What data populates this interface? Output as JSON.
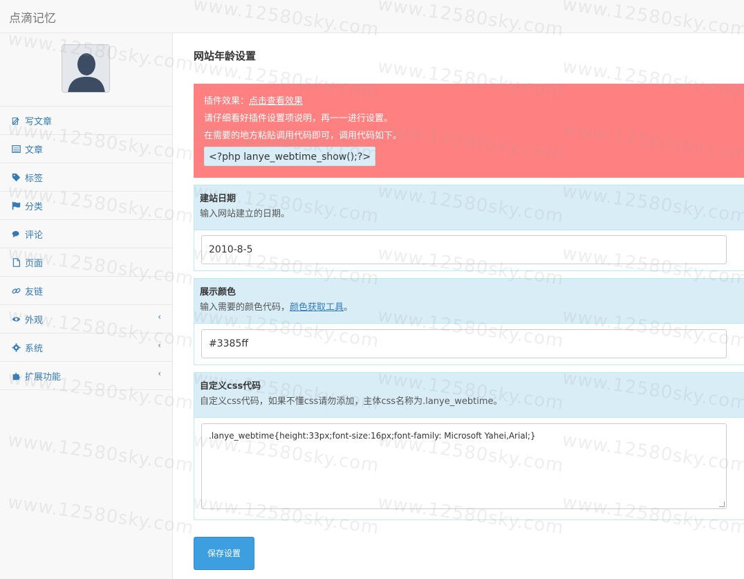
{
  "brand": "点滴记忆",
  "sidebar": {
    "items": [
      {
        "label": "写文章",
        "icon": "edit-icon",
        "has_arrow": false
      },
      {
        "label": "文章",
        "icon": "list-icon",
        "has_arrow": false
      },
      {
        "label": "标签",
        "icon": "tags-icon",
        "has_arrow": false
      },
      {
        "label": "分类",
        "icon": "flag-icon",
        "has_arrow": false
      },
      {
        "label": "评论",
        "icon": "comments-icon",
        "has_arrow": false
      },
      {
        "label": "页面",
        "icon": "file-icon",
        "has_arrow": false
      },
      {
        "label": "友链",
        "icon": "link-icon",
        "has_arrow": false
      },
      {
        "label": "外观",
        "icon": "eye-icon",
        "has_arrow": true
      },
      {
        "label": "系统",
        "icon": "gear-icon",
        "has_arrow": true
      },
      {
        "label": "扩展功能",
        "icon": "puzzle-icon",
        "has_arrow": true
      }
    ],
    "arrow_glyph": "‹"
  },
  "main": {
    "title": "网站年龄设置",
    "alert": {
      "line1_prefix": "插件效果：",
      "line1_link": "点击查看效果",
      "line2": "请仔细看好插件设置项说明，再一一进行设置。",
      "line3": "在需要的地方粘贴调用代码即可，调用代码如下。",
      "code": "<?php lanye_webtime_show();?>"
    },
    "fields": [
      {
        "title": "建站日期",
        "desc": "输入网站建立的日期。",
        "value": "2010-8-5"
      },
      {
        "title": "展示颜色",
        "desc_prefix": "输入需要的颜色代码，",
        "desc_link": "颜色获取工具",
        "desc_suffix": "。",
        "value": "#3385ff"
      },
      {
        "title": "自定义css代码",
        "desc": "自定义css代码，如果不懂css请勿添加，主体css名称为.lanye_webtime。",
        "value": ".lanye_webtime{height:33px;font-size:16px;font-family: Microsoft Yahei,Arial;}"
      }
    ],
    "save_label": "保存设置"
  },
  "watermark": "www.12580sky.com",
  "colors": {
    "alert_bg": "#ff8080",
    "panel_head_bg": "#d9edf7",
    "link": "#337ab7",
    "button": "#3d9fe0"
  }
}
